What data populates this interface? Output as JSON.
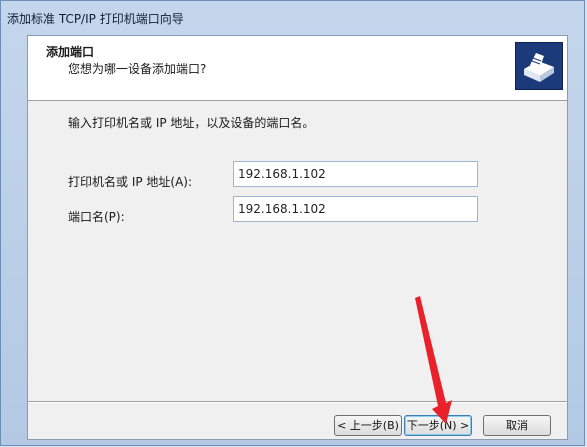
{
  "window": {
    "title": "添加标准 TCP/IP 打印机端口向导"
  },
  "header": {
    "title": "添加端口",
    "subtitle": "您想为哪一设备添加端口?",
    "icon": "printer-icon"
  },
  "content": {
    "instruction": "输入打印机名或 IP 地址，以及设备的端口名。",
    "ip_label": "打印机名或 IP 地址(A):",
    "ip_value": "192.168.1.102",
    "port_label": "端口名(P):",
    "port_value": "192.168.1.102"
  },
  "buttons": {
    "back": "< 上一步(B)",
    "next": "下一步(N) >",
    "cancel": "取消"
  },
  "annotation": {
    "arrow_color": "#e8212b"
  }
}
